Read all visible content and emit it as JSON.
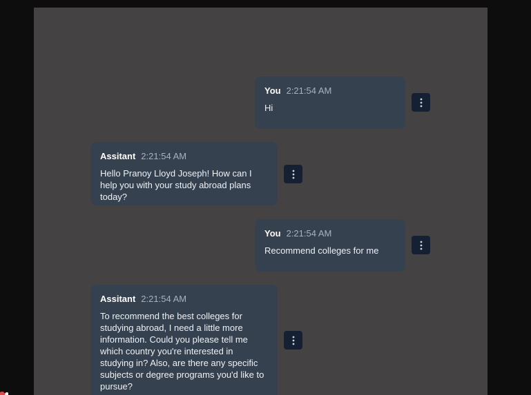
{
  "messages": [
    {
      "author": "You",
      "time": "2:21:54 AM",
      "text": "Hi"
    },
    {
      "author": "Assitant",
      "time": "2:21:54 AM",
      "text": "Hello Pranoy Lloyd Joseph! How can I help you with your study abroad plans today?"
    },
    {
      "author": "You",
      "time": "2:21:54 AM",
      "text": "Recommend colleges for me"
    },
    {
      "author": "Assitant",
      "time": "2:21:54 AM",
      "text": "To recommend the best colleges for studying abroad, I need a little more information. Could you please tell me which country you're interested in studying in? Also, are there any specific subjects or degree programs you'd like to pursue?"
    }
  ],
  "colors": {
    "page_bg": "#0d0d0e",
    "panel_bg": "#454244",
    "bubble_bg": "#364150",
    "menu_button_bg": "#162033",
    "timestamp": "#a9b1bd"
  },
  "icons": {
    "message_menu": "more-vertical-icon"
  }
}
